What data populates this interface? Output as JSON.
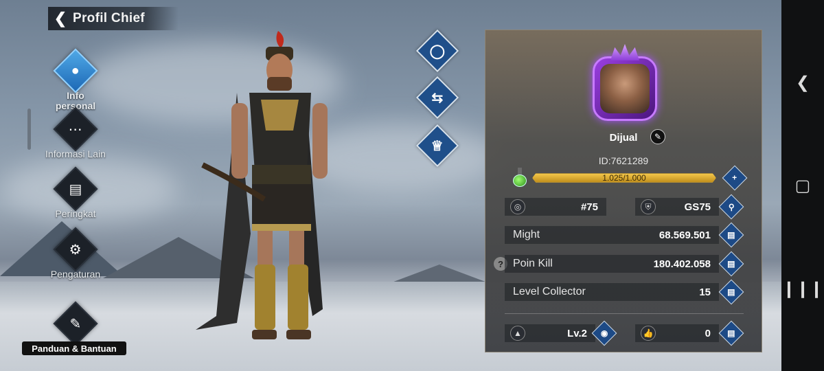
{
  "header": {
    "title": "Profil Chief"
  },
  "left_menu": [
    {
      "label": "Info personal",
      "icon": "profile-icon",
      "active": true
    },
    {
      "label": "Informasi Lain",
      "icon": "more-icon",
      "active": false
    },
    {
      "label": "Peringkat",
      "icon": "ranking-icon",
      "active": false
    },
    {
      "label": "Pengaturan",
      "icon": "gear-icon",
      "active": false
    },
    {
      "label": "Panduan & Bantuan",
      "icon": "book-icon",
      "active": false
    }
  ],
  "action_buttons": [
    {
      "icon": "laurel-icon"
    },
    {
      "icon": "swap-icon"
    },
    {
      "icon": "crown-icon"
    }
  ],
  "profile": {
    "name": "Dijual",
    "id_text": "ID:7621289",
    "exp_text": "1.025/1.000",
    "exp_fraction": 1.0,
    "rank": "#75",
    "gs": "GS75",
    "might_label": "Might",
    "might_value": "68.569.501",
    "kill_label": "Poin Kill",
    "kill_value": "180.402.058",
    "collector_label": "Level Collector",
    "collector_value": "15",
    "level": "Lv.2",
    "likes": "0"
  },
  "colors": {
    "accent_blue": "#1d4a86",
    "exp_gold": "#f3c64a",
    "avatar_purple": "#9a3fe0"
  }
}
